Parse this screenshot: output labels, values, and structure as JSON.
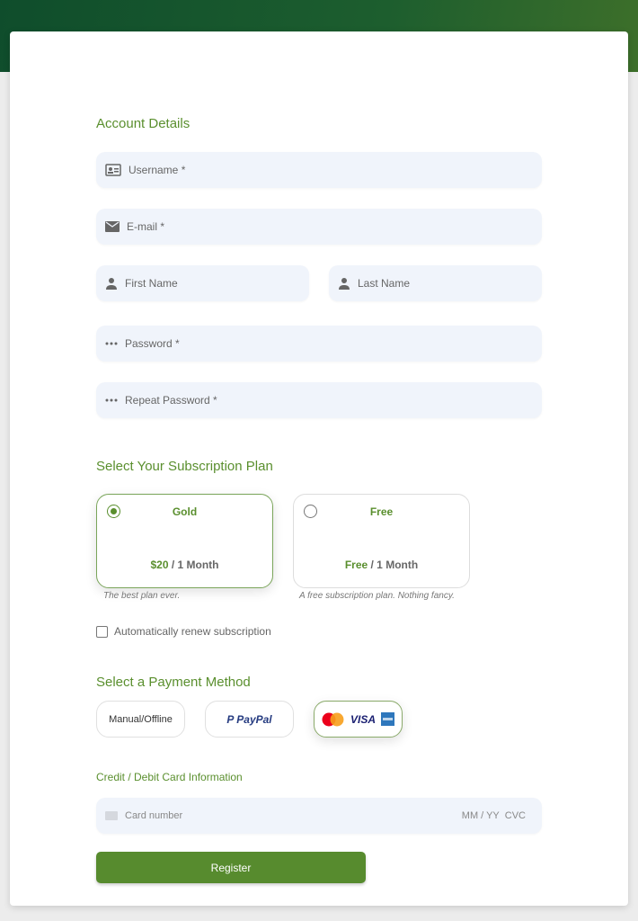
{
  "account": {
    "title": "Account Details",
    "username": "Username *",
    "email": "E-mail *",
    "first_name": "First Name",
    "last_name": "Last Name",
    "password": "Password *",
    "repeat_password": "Repeat Password *"
  },
  "subscription": {
    "title": "Select Your Subscription Plan",
    "plans": [
      {
        "name": "Gold",
        "price": "$20",
        "period": "/ 1 Month",
        "description": "The best plan ever.",
        "selected": true
      },
      {
        "name": "Free",
        "price": "Free",
        "period": "/ 1 Month",
        "description": "A free subscription plan. Nothing fancy.",
        "selected": false
      }
    ],
    "auto_renew_label": "Automatically renew subscription",
    "auto_renew_checked": false
  },
  "payment": {
    "title": "Select a Payment Method",
    "methods": [
      {
        "label": "Manual/Offline"
      },
      {
        "label": "PayPal"
      },
      {
        "label": "VISA",
        "selected": true
      }
    ],
    "card_title": "Credit / Debit Card Information",
    "card_number": "Card number",
    "expiry": "MM / YY",
    "cvc": "CVC"
  },
  "register_label": "Register",
  "colors": {
    "accent": "#5a8f2e",
    "field_bg": "#f0f4fb"
  }
}
